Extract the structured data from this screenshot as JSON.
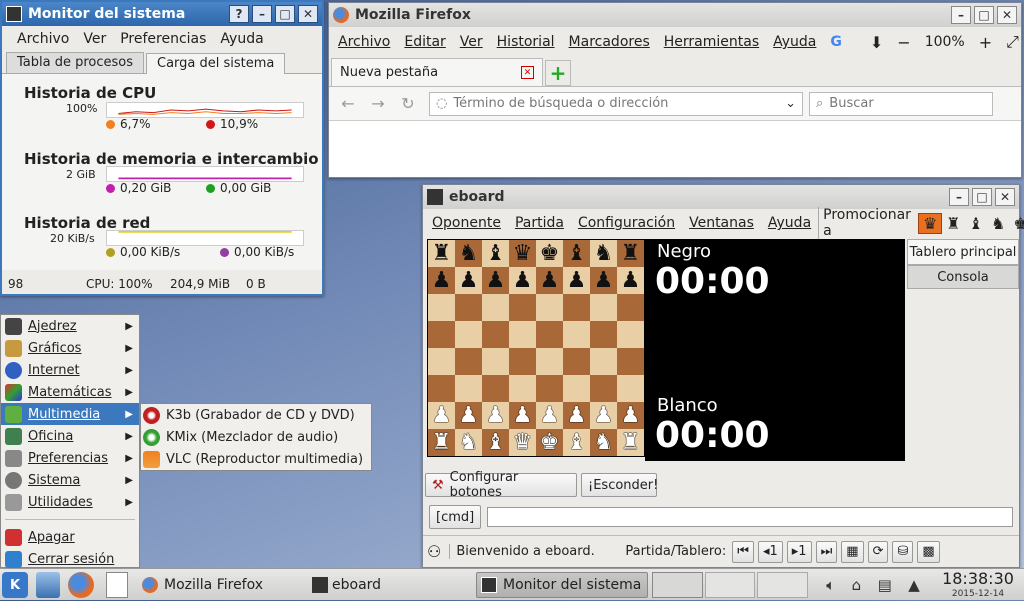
{
  "sysmon": {
    "title": "Monitor del sistema",
    "menus": [
      "Archivo",
      "Ver",
      "Preferencias",
      "Ayuda"
    ],
    "tabs": [
      "Tabla de procesos",
      "Carga del sistema"
    ],
    "cpu": {
      "title": "Historia de CPU",
      "scale": "100%",
      "legend": [
        {
          "label": "6,7%",
          "color": "#f08020"
        },
        {
          "label": "10,9%",
          "color": "#d01818"
        }
      ]
    },
    "mem": {
      "title": "Historia de memoria e intercambio",
      "scale": "2 GiB",
      "legend": [
        {
          "label": "0,20 GiB",
          "color": "#c020b0"
        },
        {
          "label": "0,00 GiB",
          "color": "#20a020"
        }
      ]
    },
    "net": {
      "title": "Historia de red",
      "scale": "20 KiB/s",
      "legend": [
        {
          "label": "0,00 KiB/s",
          "color": "#b0a020"
        },
        {
          "label": "0,00 KiB/s",
          "color": "#9040a0"
        }
      ]
    },
    "status": {
      "procs": "98",
      "cpu": "CPU: 100%",
      "mem": "204,9 MiB",
      "swap": "0 B"
    }
  },
  "firefox": {
    "title": "Mozilla Firefox",
    "menus": [
      "Archivo",
      "Editar",
      "Ver",
      "Historial",
      "Marcadores",
      "Herramientas",
      "Ayuda"
    ],
    "zoom": "100%",
    "tab": "Nueva pestaña",
    "url_placeholder": "Término de búsqueda o dirección",
    "search_placeholder": "Buscar"
  },
  "eboard": {
    "title": "eboard",
    "menus": [
      "Oponente",
      "Partida",
      "Configuración",
      "Ventanas",
      "Ayuda"
    ],
    "promote": "Promocionar a",
    "side_tabs": [
      "Tablero principal",
      "Consola"
    ],
    "black": {
      "label": "Negro",
      "clock": "00:00"
    },
    "white": {
      "label": "Blanco",
      "clock": "00:00"
    },
    "btn_config": "Configurar botones",
    "btn_hide": "¡Esconder!",
    "cmd": "[cmd]",
    "status": "Bienvenido a eboard.",
    "game_label": "Partida/Tablero:",
    "nav": [
      "1",
      "1"
    ]
  },
  "kmenu": {
    "items": [
      "Ajedrez",
      "Gráficos",
      "Internet",
      "Matemáticas",
      "Multimedia",
      "Oficina",
      "Preferencias",
      "Sistema",
      "Utilidades"
    ],
    "highlight": "Multimedia",
    "actions": [
      "Apagar",
      "Cerrar sesión"
    ],
    "submenu": [
      "K3b (Grabador de CD y DVD)",
      "KMix (Mezclador de audio)",
      "VLC (Reproductor multimedia)"
    ]
  },
  "taskbar": {
    "tasks": [
      "Mozilla Firefox",
      "eboard",
      "Monitor del sistema"
    ],
    "time": "18:38:30",
    "date": "2015-12-14"
  }
}
